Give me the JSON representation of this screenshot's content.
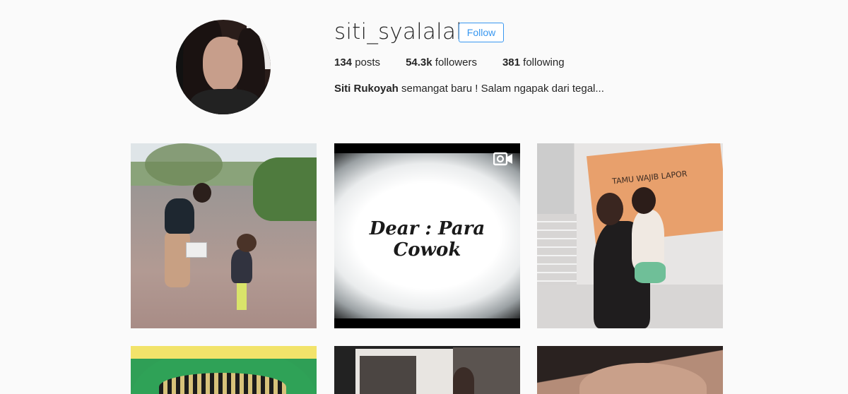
{
  "profile": {
    "username": "siti_syalalah",
    "follow_label": "Follow",
    "stats": {
      "posts_count": "134",
      "posts_label": "posts",
      "followers_count": "54.3k",
      "followers_label": "followers",
      "following_count": "381",
      "following_label": "following"
    },
    "bio_name": "Siti Rukoyah",
    "bio_text": "semangat baru ! Salam ngapak dari tegal..."
  },
  "posts": {
    "tile2_caption": "Dear : Para Cowok",
    "tile3_sign_text": "TAMU WAJIB LAPOR",
    "tile2_badge": "video-camera-icon"
  },
  "colors": {
    "accent": "#3897f0",
    "background": "#fafafa",
    "text": "#262626"
  }
}
